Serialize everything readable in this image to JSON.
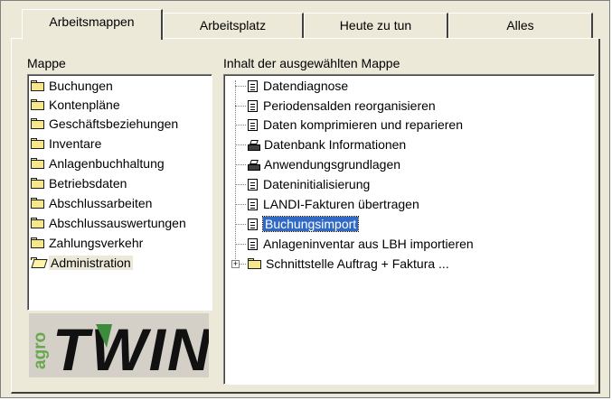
{
  "tabs": [
    {
      "label": "Arbeitsmappen",
      "active": true
    },
    {
      "label": "Arbeitsplatz",
      "active": false
    },
    {
      "label": "Heute zu tun",
      "active": false
    },
    {
      "label": "Alles",
      "active": false
    }
  ],
  "left": {
    "heading": "Mappe",
    "items": [
      {
        "label": "Buchungen"
      },
      {
        "label": "Kontenpläne"
      },
      {
        "label": "Geschäftsbeziehungen"
      },
      {
        "label": "Inventare"
      },
      {
        "label": "Anlagenbuchhaltung"
      },
      {
        "label": "Betriebsdaten"
      },
      {
        "label": "Abschlussarbeiten"
      },
      {
        "label": "Abschlussauswertungen"
      },
      {
        "label": "Zahlungsverkehr"
      },
      {
        "label": "Administration",
        "selected": true
      }
    ]
  },
  "right": {
    "heading": "Inhalt der ausgewählten Mappe",
    "items": [
      {
        "label": "Datendiagnose",
        "icon": "document-icon"
      },
      {
        "label": "Periodensalden reorganisieren",
        "icon": "document-icon"
      },
      {
        "label": "Daten komprimieren und reparieren",
        "icon": "document-icon"
      },
      {
        "label": "Datenbank Informationen",
        "icon": "printer-icon"
      },
      {
        "label": "Anwendungsgrundlagen",
        "icon": "printer-icon"
      },
      {
        "label": "Dateninitialisierung",
        "icon": "document-icon"
      },
      {
        "label": "LANDI-Fakturen übertragen",
        "icon": "document-icon"
      },
      {
        "label": "Buchungsimport",
        "icon": "document-icon",
        "selected": true
      },
      {
        "label": "Anlageninventar aus LBH importieren",
        "icon": "document-icon"
      },
      {
        "label": "Schnittstelle Auftrag + Faktura ...",
        "icon": "folder-icon",
        "expandable": true
      }
    ]
  },
  "logo": {
    "small": "agro",
    "big": "TWIN"
  },
  "colors": {
    "selection": "#316ac5",
    "face": "#ece9d8",
    "logo_bg": "#d4d0c8"
  }
}
